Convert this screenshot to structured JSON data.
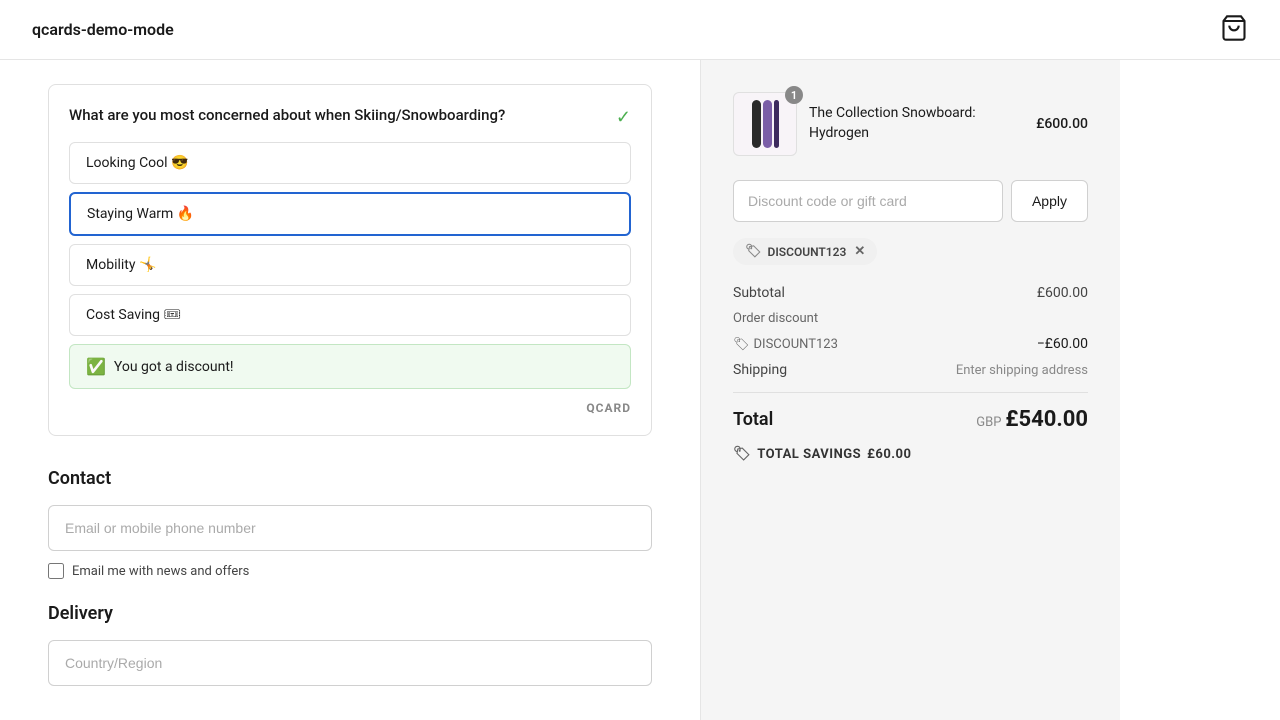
{
  "header": {
    "title": "qcards-demo-mode",
    "cart_icon": "shopping-bag"
  },
  "qcard": {
    "question": "What are you most concerned about when Skiing/Snowboarding?",
    "options": [
      {
        "id": "looking-cool",
        "label": "Looking Cool 😎",
        "selected": false
      },
      {
        "id": "staying-warm",
        "label": "Staying Warm 🔥",
        "selected": true
      },
      {
        "id": "mobility",
        "label": "Mobility 🤸",
        "selected": false
      },
      {
        "id": "cost-saving",
        "label": "Cost Saving 🎟",
        "selected": false
      }
    ],
    "discount_banner": "You got a discount!",
    "branding": "QCARD"
  },
  "contact": {
    "section_title": "Contact",
    "email_placeholder": "Email or mobile phone number",
    "newsletter_label": "Email me with news and offers"
  },
  "delivery": {
    "section_title": "Delivery",
    "country_placeholder": "Country/Region"
  },
  "order_summary": {
    "product_name": "The Collection Snowboard: Hydrogen",
    "product_price": "£600.00",
    "product_badge": "1",
    "discount_placeholder": "Discount code or gift card",
    "apply_label": "Apply",
    "applied_code": "DISCOUNT123",
    "subtotal_label": "Subtotal",
    "subtotal_value": "£600.00",
    "order_discount_label": "Order discount",
    "discount_code_label": "DISCOUNT123",
    "discount_amount": "−£60.00",
    "shipping_label": "Shipping",
    "shipping_value": "Enter shipping address",
    "total_label": "Total",
    "total_currency": "GBP",
    "total_value": "£540.00",
    "savings_label": "TOTAL SAVINGS",
    "savings_value": "£60.00"
  }
}
